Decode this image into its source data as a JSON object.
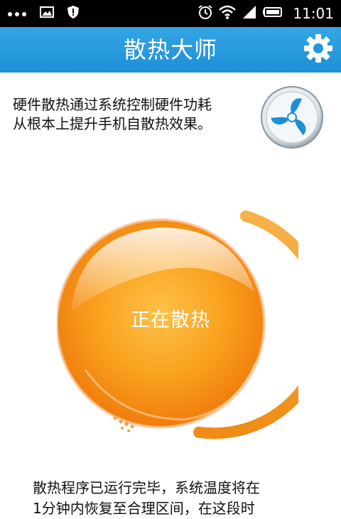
{
  "status_bar": {
    "time": "11:01",
    "icons": [
      "more-dots-icon",
      "image-icon",
      "shield-icon",
      "alarm-icon",
      "wifi-icon",
      "signal-icon",
      "battery-icon"
    ]
  },
  "app_bar": {
    "title": "散热大师",
    "settings_icon": "gear-icon",
    "color": "#2196dc"
  },
  "description": {
    "line1": "硬件散热通过系统控制硬件功耗",
    "line2": "从根本上提升手机自散热效果。"
  },
  "fan_icon": "fan-icon",
  "status_orb": {
    "label": "正在散热",
    "color": "#f7931e"
  },
  "footer": {
    "line1": "散热程序已运行完毕，系统温度将在",
    "line2": "1分钟内恢复至合理区间，在这段时"
  }
}
